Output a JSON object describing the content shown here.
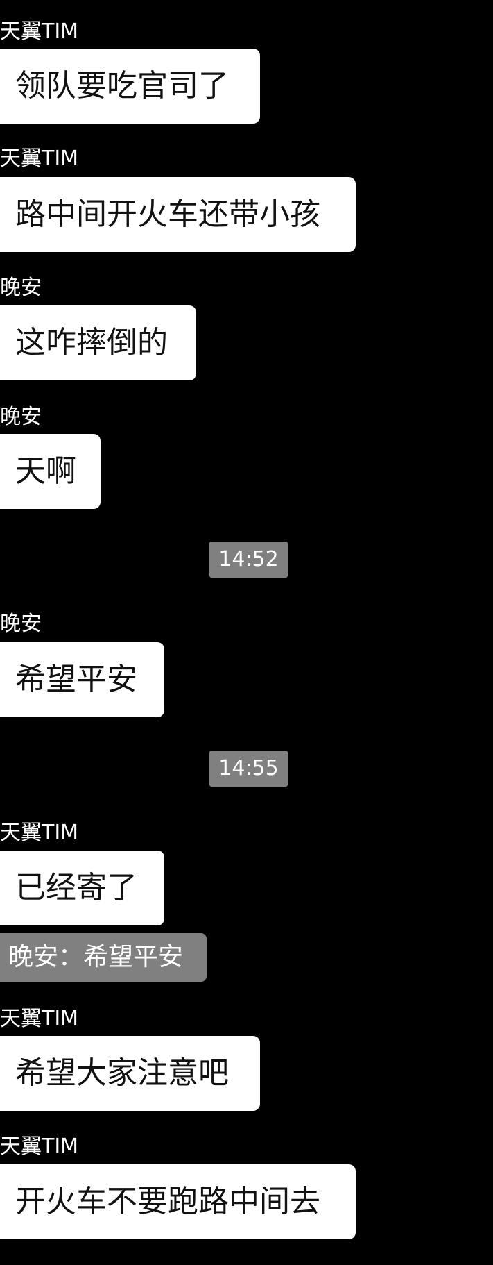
{
  "chat": {
    "messages": [
      {
        "sender": "天翼TIM",
        "text": "领队要吃官司了"
      },
      {
        "sender": "天翼TIM",
        "text": "路中间开火车还带小孩"
      },
      {
        "sender": "晚安",
        "text": "这咋摔倒的"
      },
      {
        "sender": "晚安",
        "text": "天啊"
      },
      {
        "timestamp": "14:52"
      },
      {
        "sender": "晚安",
        "text": "希望平安"
      },
      {
        "timestamp": "14:55"
      },
      {
        "sender": "天翼TIM",
        "text": "已经寄了",
        "quote": "晚安：希望平安"
      },
      {
        "sender": "天翼TIM",
        "text": "希望大家注意吧"
      },
      {
        "sender": "天翼TIM",
        "text": "开火车不要跑路中间去"
      }
    ]
  },
  "colors": {
    "background": "#000000",
    "bubble": "#ffffff",
    "timestamp_bg": "#808080",
    "quote_bg": "#808080"
  }
}
